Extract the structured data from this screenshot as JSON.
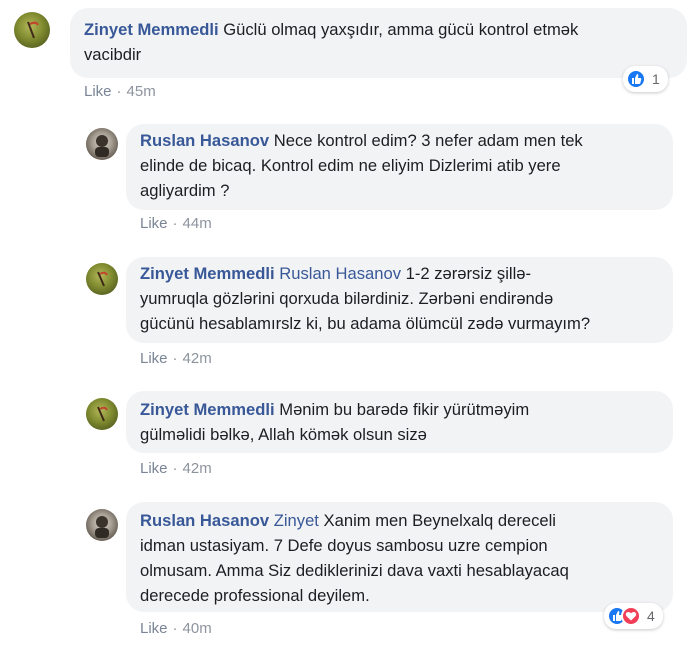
{
  "comments": [
    {
      "author": "Zinyet Memmedli",
      "mention": "",
      "text": "Güclü olmaq yaxşıdır, amma gücü kontrol etmək",
      "text2": "vacibdir",
      "like_label": "Like",
      "time": "45m",
      "reaction_count": "1"
    },
    {
      "author": "Ruslan Hasanov",
      "mention": "",
      "text": "Nece kontrol edim? 3 nefer adam men tek",
      "text2": "elinde de bicaq. Kontrol edim ne eliyim Dizlerimi atib yere",
      "text3": "agliyardim ?",
      "like_label": "Like",
      "time": "44m"
    },
    {
      "author": "Zinyet Memmedli",
      "mention": "Ruslan Hasanov",
      "text": "1-2 zərərsiz şillə-",
      "text2": "yumruqla gözlərini qorxuda bilərdiniz. Zərbəni endirəndə",
      "text3": "gücünü hesablamırslz ki, bu adama ölümcül zədə vurmayım?",
      "like_label": "Like",
      "time": "42m"
    },
    {
      "author": "Zinyet Memmedli",
      "mention": "",
      "text": "Mənim bu barədə fikir yürütməyim",
      "text2": "gülməlidi bəlkə, Allah kömək olsun sizə",
      "like_label": "Like",
      "time": "42m"
    },
    {
      "author": "Ruslan Hasanov",
      "mention": "Zinyet",
      "text": "Xanim men Beynelxalq dereceli",
      "text2": "idman ustasiyam. 7 Defe doyus sambosu uzre cempion",
      "text3": "olmusam. Amma Siz dediklerinizi dava vaxti hesablayacaq",
      "text4": "derecede professional deyilem.",
      "like_label": "Like",
      "time": "40m",
      "reaction_count": "4"
    }
  ],
  "icons": {
    "like": "like-thumb-icon",
    "love": "heart-icon"
  },
  "colors": {
    "author": "#385898",
    "bubble": "#f2f3f5",
    "like_reaction": "#1877f2",
    "love_reaction": "#f33e58"
  }
}
